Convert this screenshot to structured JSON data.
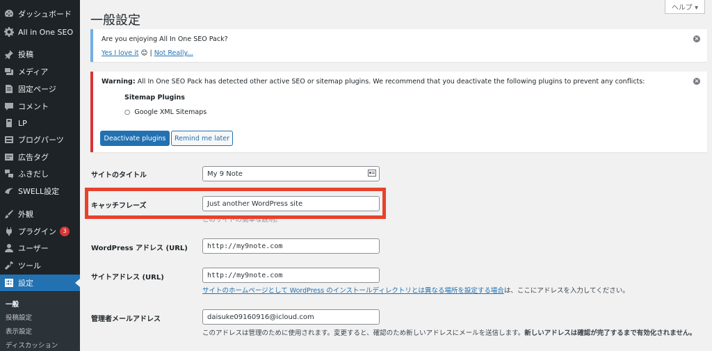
{
  "sidebar": {
    "items": [
      {
        "label": "ダッシュボード",
        "icon": "dashboard-icon"
      },
      {
        "label": "All in One SEO",
        "icon": "gear-icon"
      },
      {
        "label": "投稿",
        "icon": "pin-icon"
      },
      {
        "label": "メディア",
        "icon": "media-icon"
      },
      {
        "label": "固定ページ",
        "icon": "page-icon"
      },
      {
        "label": "コメント",
        "icon": "comment-icon"
      },
      {
        "label": "LP",
        "icon": "lp-icon"
      },
      {
        "label": "ブログパーツ",
        "icon": "blog-parts-icon"
      },
      {
        "label": "広告タグ",
        "icon": "ad-tag-icon"
      },
      {
        "label": "ふきだし",
        "icon": "speech-bubble-icon"
      },
      {
        "label": "SWELL設定",
        "icon": "swell-icon"
      },
      {
        "label": "外観",
        "icon": "brush-icon"
      },
      {
        "label": "プラグイン",
        "icon": "plugin-icon",
        "badge": "3"
      },
      {
        "label": "ユーザー",
        "icon": "user-icon"
      },
      {
        "label": "ツール",
        "icon": "wrench-icon"
      },
      {
        "label": "設定",
        "icon": "settings-icon",
        "current": true
      }
    ],
    "submenu": [
      "一般",
      "投稿設定",
      "表示設定",
      "ディスカッション"
    ]
  },
  "help_tab": "ヘルプ ▾",
  "page_title": "一般設定",
  "notice_info": {
    "question": "Are you enjoying All In One SEO Pack?",
    "yes": "Yes I love it",
    "emoji": "😊",
    "separator": "|",
    "no": "Not Really..."
  },
  "notice_warning": {
    "prefix": "Warning:",
    "message": "All In One SEO Pack has detected other active SEO or sitemap plugins. We recommend that you deactivate the following plugins to prevent any conflicts:",
    "heading": "Sitemap Plugins",
    "plugin": "Google XML Sitemaps",
    "deactivate_btn": "Deactivate plugins",
    "remind_btn": "Remind me later"
  },
  "form": {
    "site_title": {
      "label": "サイトのタイトル",
      "value": "My 9 Note"
    },
    "tagline": {
      "label": "キャッチフレーズ",
      "value": "Just another WordPress site",
      "desc": "このサイトの簡単な説明。"
    },
    "wp_url": {
      "label": "WordPress アドレス (URL)",
      "value": "http://my9note.com"
    },
    "site_url": {
      "label": "サイトアドレス (URL)",
      "value": "http://my9note.com",
      "desc_link": "サイトのホームページとして WordPress のインストールディレクトリとは異なる場所を設定する場合",
      "desc_rest": "は、ここにアドレスを入力してください。"
    },
    "admin_email": {
      "label": "管理者メールアドレス",
      "value": "daisuke09160916@icloud.com",
      "desc": "このアドレスは管理のために使用されます。変更すると、確認のため新しいアドレスにメールを送信します。",
      "desc_bold": "新しいアドレスは確認が完了するまで有効化されません。"
    }
  },
  "colors": {
    "sidebar_bg": "#1d2327",
    "accent": "#2271b1",
    "warning": "#d63638",
    "highlight": "#e8412e"
  }
}
